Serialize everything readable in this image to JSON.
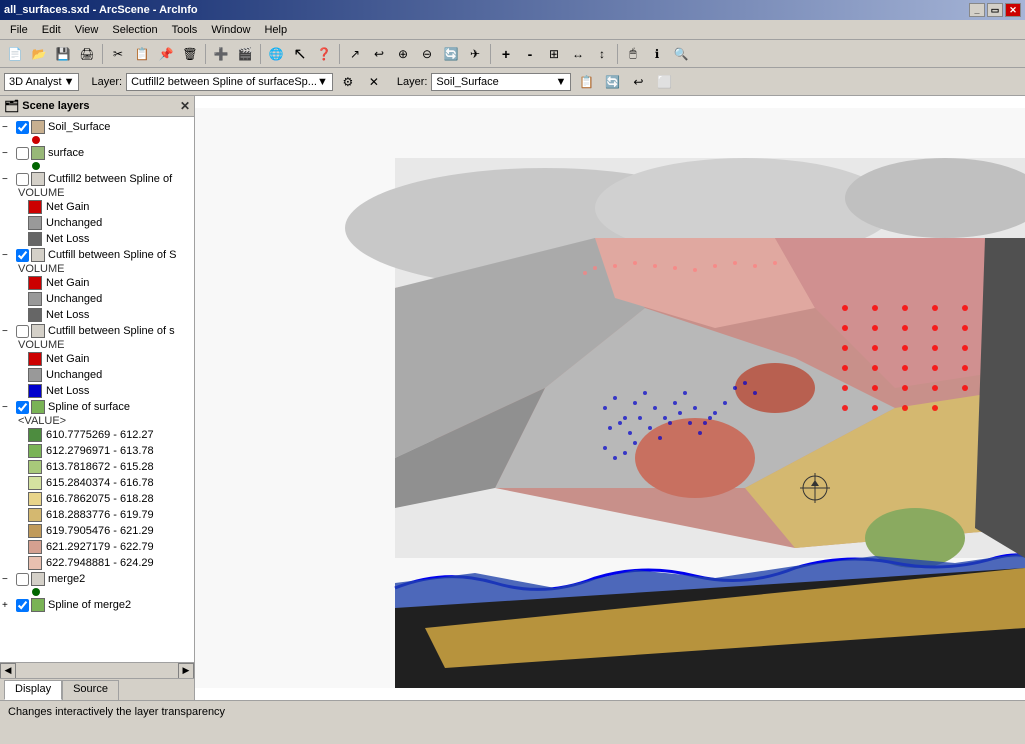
{
  "window": {
    "title": "all_surfaces.sxd - ArcScene - ArcInfo",
    "icon": "🗺"
  },
  "menu": {
    "items": [
      "File",
      "Edit",
      "View",
      "Selection",
      "Tools",
      "Window",
      "Help"
    ]
  },
  "toolbar1": {
    "buttons": [
      {
        "name": "new",
        "icon": "📄"
      },
      {
        "name": "open",
        "icon": "📂"
      },
      {
        "name": "save",
        "icon": "💾"
      },
      {
        "name": "print",
        "icon": "🖨"
      },
      {
        "name": "cut",
        "icon": "✂"
      },
      {
        "name": "copy",
        "icon": "📋"
      },
      {
        "name": "paste",
        "icon": "📌"
      },
      {
        "name": "delete",
        "icon": "🗑"
      },
      {
        "name": "add-data",
        "icon": "➕"
      },
      {
        "name": "3d-scene",
        "icon": "🎬"
      },
      {
        "name": "globe1",
        "icon": "🌐"
      },
      {
        "name": "cursor",
        "icon": "↖"
      },
      {
        "name": "help",
        "icon": "❓"
      },
      {
        "name": "navigate",
        "icon": "↗"
      },
      {
        "name": "pan-back",
        "icon": "↩"
      },
      {
        "name": "zoom-in-fixed",
        "icon": "🔍"
      },
      {
        "name": "zoom-out-fixed",
        "icon": "🔎"
      },
      {
        "name": "rotate",
        "icon": "🔄"
      },
      {
        "name": "fly",
        "icon": "✈"
      },
      {
        "name": "zoom-in",
        "icon": "⊕"
      },
      {
        "name": "zoom-out",
        "icon": "⊖"
      },
      {
        "name": "full-extent",
        "icon": "⊞"
      },
      {
        "name": "fixed-zoom-in",
        "icon": "↔"
      },
      {
        "name": "fixed-zoom-out",
        "icon": "↕"
      },
      {
        "name": "select",
        "icon": "🖱"
      },
      {
        "name": "identify",
        "icon": "ℹ"
      },
      {
        "name": "find",
        "icon": "🔎"
      }
    ]
  },
  "toolbar2": {
    "analyst_label": "3D Analyst",
    "layer_label1": "Layer:",
    "layer_value1": "Cutfill2 between Spline of surfaceSp...",
    "layer_label2": "Layer:",
    "layer_value2": "Soil_Surface"
  },
  "panel": {
    "title": "Scene layers",
    "layers": [
      {
        "id": "soil-surface",
        "label": "Soil_Surface",
        "checked": true,
        "expanded": true,
        "indent": 0,
        "children": []
      },
      {
        "id": "surface",
        "label": "surface",
        "checked": false,
        "expanded": false,
        "indent": 0,
        "children": []
      },
      {
        "id": "cutfill2",
        "label": "Cutfill2 between Spline of",
        "checked": false,
        "expanded": true,
        "indent": 0,
        "sublabel": "VOLUME",
        "legend": [
          {
            "color": "#cc0000",
            "label": "Net Gain"
          },
          {
            "color": "#999999",
            "label": "Unchanged"
          },
          {
            "color": "#666666",
            "label": "Net Loss"
          }
        ]
      },
      {
        "id": "cutfill-spline5",
        "label": "Cutfill between Spline of S",
        "checked": true,
        "expanded": true,
        "indent": 0,
        "sublabel": "VOLUME",
        "legend": [
          {
            "color": "#cc0000",
            "label": "Net Gain"
          },
          {
            "color": "#999999",
            "label": "Unchanged"
          },
          {
            "color": "#666666",
            "label": "Net Loss"
          }
        ]
      },
      {
        "id": "cutfill-splines",
        "label": "Cutfill between Spline of s",
        "checked": false,
        "expanded": true,
        "indent": 0,
        "sublabel": "VOLUME",
        "legend": [
          {
            "color": "#cc0000",
            "label": "Net Gain"
          },
          {
            "color": "#999999",
            "label": "Unchanged"
          },
          {
            "color": "#0000cc",
            "label": "Net Loss"
          }
        ]
      },
      {
        "id": "spline-surface",
        "label": "Spline of surface",
        "checked": true,
        "expanded": true,
        "indent": 0,
        "sublabel": "<VALUE>",
        "legend": [
          {
            "color": "#4d8c3f",
            "label": "610.7775269 - 612.27"
          },
          {
            "color": "#7ab356",
            "label": "612.2796971 - 613.78"
          },
          {
            "color": "#a8c97a",
            "label": "613.7818672 - 615.28"
          },
          {
            "color": "#d4e2a0",
            "label": "615.2840374 - 616.78"
          },
          {
            "color": "#e8d48a",
            "label": "616.7862075 - 618.28"
          },
          {
            "color": "#d4b870",
            "label": "618.2883776 - 619.79"
          },
          {
            "color": "#c09a5a",
            "label": "619.7905476 - 621.29"
          },
          {
            "color": "#d4a090",
            "label": "621.2927179 - 622.79"
          },
          {
            "color": "#e8c0b0",
            "label": "622.7948881 - 624.29"
          }
        ]
      },
      {
        "id": "merge2",
        "label": "merge2",
        "checked": false,
        "expanded": true,
        "indent": 0
      },
      {
        "id": "spline-merge2",
        "label": "Spline of merge2",
        "checked": true,
        "expanded": false,
        "indent": 0
      }
    ]
  },
  "tabs": [
    {
      "id": "display",
      "label": "Display",
      "active": true
    },
    {
      "id": "source",
      "label": "Source",
      "active": false
    }
  ],
  "status": {
    "text": "Changes interactively the layer transparency"
  }
}
